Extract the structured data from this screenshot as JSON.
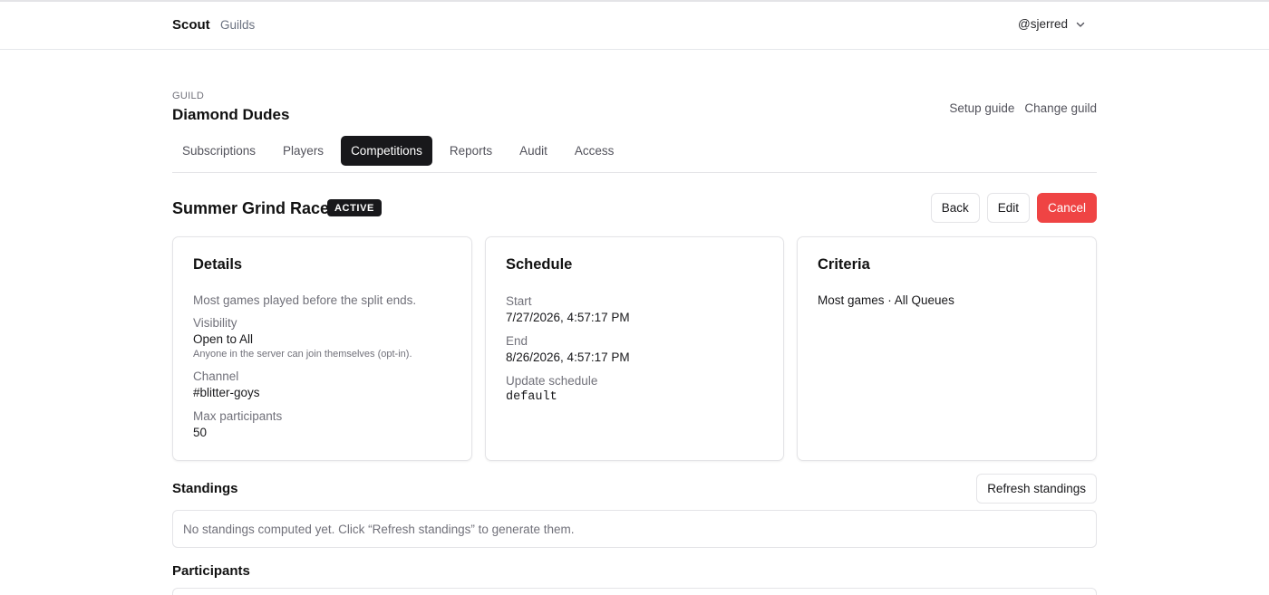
{
  "nav": {
    "brand": "Scout",
    "link": "Guilds",
    "user": "@sjerred"
  },
  "guild": {
    "eyebrow": "GUILD",
    "name": "Diamond Dudes",
    "links": [
      "Setup guide",
      "Change guild"
    ]
  },
  "tabs": [
    {
      "label": "Subscriptions",
      "active": false
    },
    {
      "label": "Players",
      "active": false
    },
    {
      "label": "Competitions",
      "active": true
    },
    {
      "label": "Reports",
      "active": false
    },
    {
      "label": "Audit",
      "active": false
    },
    {
      "label": "Access",
      "active": false
    }
  ],
  "competition": {
    "title": "Summer Grind Race",
    "status": "ACTIVE",
    "actions": {
      "back": "Back",
      "edit": "Edit",
      "cancel": "Cancel"
    }
  },
  "details": {
    "heading": "Details",
    "description": "Most games played before the split ends.",
    "visibility_label": "Visibility",
    "visibility_value": "Open to All",
    "visibility_hint": "Anyone in the server can join themselves (opt-in).",
    "channel_label": "Channel",
    "channel_value": "#blitter-goys",
    "max_label": "Max participants",
    "max_value": "50"
  },
  "schedule": {
    "heading": "Schedule",
    "start_label": "Start",
    "start_value": "7/27/2026, 4:57:17 PM",
    "end_label": "End",
    "end_value": "8/26/2026, 4:57:17 PM",
    "update_label": "Update schedule",
    "update_value": "default"
  },
  "criteria": {
    "heading": "Criteria",
    "value": "Most games · All Queues"
  },
  "standings": {
    "title": "Standings",
    "refresh_label": "Refresh standings",
    "empty_text": "No standings computed yet. Click “Refresh standings” to generate them."
  },
  "participants": {
    "title": "Participants"
  },
  "colors": {
    "accent": "#18181b",
    "danger": "#ef4444",
    "border": "#e4e4e7",
    "muted": "#71717a"
  },
  "icons": {
    "user_menu": "chevron-down-icon"
  }
}
